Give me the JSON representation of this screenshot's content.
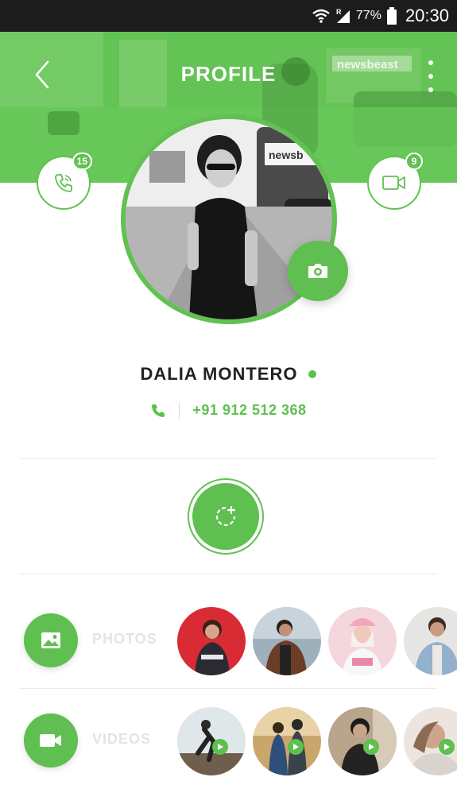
{
  "status_bar": {
    "battery_percent": "77%",
    "time": "20:30",
    "icons": [
      "wifi-icon",
      "signal-icon",
      "battery-icon"
    ]
  },
  "header": {
    "title": "PROFILE",
    "back_icon": "chevron-left-icon",
    "menu_icon": "more-vertical-icon"
  },
  "profile": {
    "name": "DALIA MONTERO",
    "phone": "+91 912 512 368",
    "online": true,
    "call_badge": "15",
    "video_badge": "9"
  },
  "media": {
    "photos_label": "PHOTOS",
    "videos_label": "VIDEOS"
  },
  "colors": {
    "accent": "#5fbf50",
    "status_bar": "#1c1c1c",
    "label_muted": "#e4e4e4"
  }
}
